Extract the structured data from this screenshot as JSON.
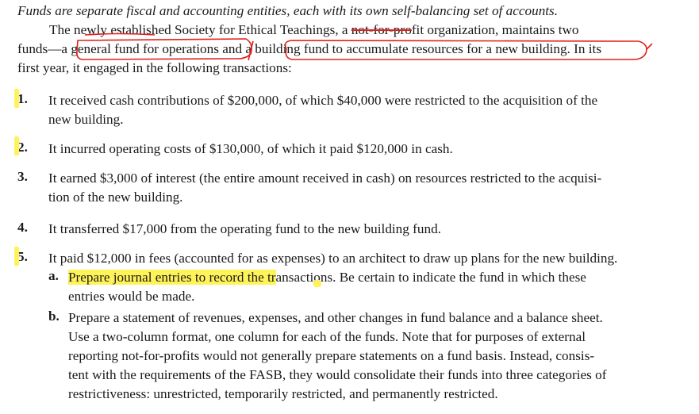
{
  "doc": {
    "heading": "Funds are separate fiscal and accounting entities, each with its own self-balancing set of accounts.",
    "intro": {
      "line1_a": "The newly established Society for Ethical Teachings, a ",
      "line1_strike": "not-for-pro",
      "line1_b": "fit organization, maintains two",
      "line2_a": "funds—a ",
      "line2_circ1": "general fund for operations",
      "line2_b": " and a ",
      "line2_circ2": "building fund to accumulate resources for a new building.",
      "line2_c": " In its",
      "line3": "first year, it engaged in the following transactions:"
    },
    "items": [
      {
        "num": "1.",
        "lines": [
          "It received cash contributions of $200,000, of which $40,000 were restricted to the acquisition of the",
          "new building."
        ]
      },
      {
        "num": "2.",
        "lines": [
          "It incurred operating costs of $130,000, of which it paid $120,000 in cash."
        ]
      },
      {
        "num": "3.",
        "lines": [
          "It earned $3,000 of interest (the entire amount received in cash) on resources restricted to the acquisi-",
          "tion of the new building."
        ]
      },
      {
        "num": "4.",
        "lines": [
          "It transferred $17,000 from the operating fund to the new building fund."
        ]
      },
      {
        "num": "5.",
        "lines": [
          "It paid $12,000 in fees (accounted for as expenses) to an architect to draw up plans for the new building."
        ]
      }
    ],
    "part_a": {
      "label": "a.",
      "highlighted": "Prepare journal entries to record the tr",
      "line1_rest": "ansactions. Be certain to indicate the fund in which these",
      "line2": "entries would be made."
    },
    "part_b": {
      "label": "b.",
      "lines": [
        "Prepare a statement of revenues, expenses, and other changes in fund balance and a balance sheet.",
        "Use a two-column format, one column for each of the funds. Note that for purposes of external",
        "reporting not-for-profits would not generally prepare statements on a fund basis. Instead, consis-",
        "tent with the requirements of the FASB, they would consolidate their funds into three categories of",
        "restrictiveness: unrestricted, temporarily restricted, and permanently restricted."
      ]
    }
  },
  "colors": {
    "highlighter": "#fff35a",
    "pen": "#e0201c",
    "text": "#1a1a1a"
  }
}
